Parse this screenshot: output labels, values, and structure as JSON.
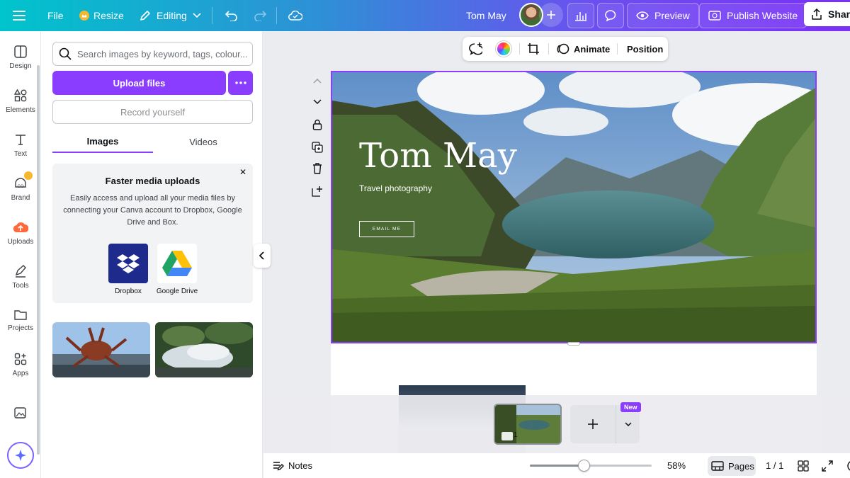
{
  "topbar": {
    "file": "File",
    "resize": "Resize",
    "editing": "Editing",
    "doc_title": "Tom May",
    "preview": "Preview",
    "publish": "Publish Website",
    "share": "Share"
  },
  "rail": {
    "items": [
      {
        "label": "Design",
        "icon": "design-icon"
      },
      {
        "label": "Elements",
        "icon": "elements-icon"
      },
      {
        "label": "Text",
        "icon": "text-icon"
      },
      {
        "label": "Brand",
        "icon": "brand-icon"
      },
      {
        "label": "Uploads",
        "icon": "uploads-icon"
      },
      {
        "label": "Tools",
        "icon": "tools-icon"
      },
      {
        "label": "Projects",
        "icon": "projects-icon"
      },
      {
        "label": "Apps",
        "icon": "apps-icon"
      }
    ]
  },
  "panel": {
    "search_placeholder": "Search images by keyword, tags, colour...",
    "upload_label": "Upload files",
    "record_label": "Record yourself",
    "tabs": [
      {
        "label": "Images",
        "active": true
      },
      {
        "label": "Videos",
        "active": false
      }
    ],
    "info_card": {
      "title": "Faster media uploads",
      "body": "Easily access and upload all your media files by connecting your Canva account to Dropbox, Google Drive and Box.",
      "providers": [
        {
          "label": "Dropbox",
          "color": "#1e2a8c"
        },
        {
          "label": "Google Drive",
          "color": "#ffffff"
        }
      ]
    }
  },
  "floating_toolbar": {
    "animate": "Animate",
    "position": "Position"
  },
  "canvas": {
    "hero_title": "Tom May",
    "hero_subtitle": "Travel photography",
    "hero_button": "EMAIL ME"
  },
  "pages_strip": {
    "new_badge": "New",
    "page_number": "1"
  },
  "bottombar": {
    "notes": "Notes",
    "zoom": "58%",
    "zoom_level": 0.45,
    "pages": "Pages",
    "page_count": "1 / 1"
  },
  "colors": {
    "accent": "#8b3dff",
    "topbar_start": "#00c4cc",
    "topbar_end": "#7b2ff7"
  }
}
